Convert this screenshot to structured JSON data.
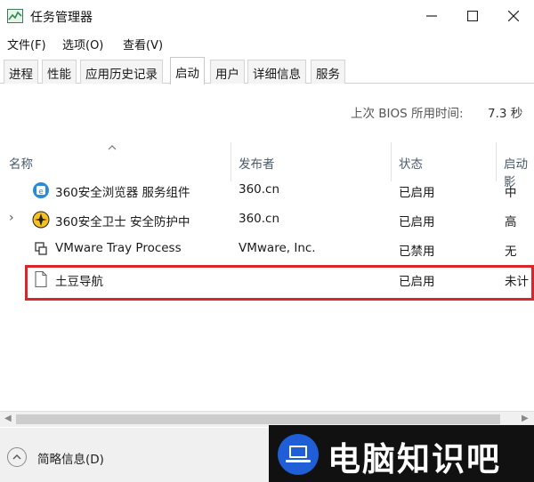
{
  "window": {
    "title": "任务管理器",
    "controls": {
      "minimize": "minimize-icon",
      "maximize": "maximize-icon",
      "close": "close-icon"
    }
  },
  "menu": [
    "文件(F)",
    "选项(O)",
    "查看(V)"
  ],
  "tabs": [
    {
      "label": "进程",
      "active": false
    },
    {
      "label": "性能",
      "active": false
    },
    {
      "label": "应用历史记录",
      "active": false
    },
    {
      "label": "启动",
      "active": true
    },
    {
      "label": "用户",
      "active": false
    },
    {
      "label": "详细信息",
      "active": false
    },
    {
      "label": "服务",
      "active": false
    }
  ],
  "bios": {
    "label": "上次 BIOS 所用时间:",
    "value": "7.3 秒"
  },
  "columns": {
    "name": "名称",
    "publisher": "发布者",
    "status": "状态",
    "impact": "启动影"
  },
  "rows": [
    {
      "icon": "browser-360-icon",
      "expandable": false,
      "name": "360安全浏览器 服务组件",
      "publisher": "360.cn",
      "status": "已启用",
      "impact": "中"
    },
    {
      "icon": "security-360-icon",
      "expandable": true,
      "name": "360安全卫士 安全防护中",
      "publisher": "360.cn",
      "status": "已启用",
      "impact": "高"
    },
    {
      "icon": "vmware-tray-icon",
      "expandable": false,
      "name": "VMware Tray Process",
      "publisher": "VMware, Inc.",
      "status": "已禁用",
      "impact": "无"
    },
    {
      "icon": "blank-file-icon",
      "expandable": false,
      "name": "土豆导航",
      "publisher": "",
      "status": "已启用",
      "impact": "未计"
    }
  ],
  "footer": {
    "fewer_details": "简略信息(D)"
  },
  "watermark": {
    "text": "电脑知识吧",
    "logo": "laptop-logo-icon"
  },
  "colors": {
    "highlight": "#d9262b",
    "watermark_bg": "#111111",
    "logo_blue": "#1f5ed6"
  }
}
